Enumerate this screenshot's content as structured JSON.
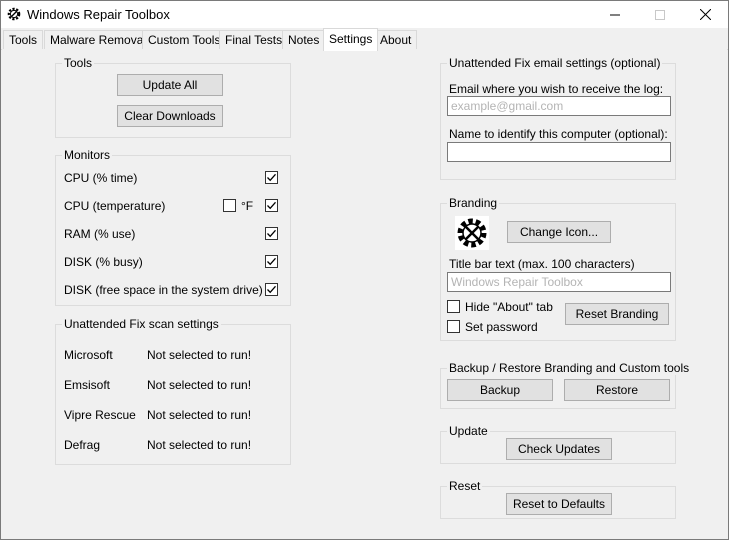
{
  "window": {
    "title": "Windows Repair Toolbox",
    "minimize_icon": "minimize-icon",
    "maximize_icon": "maximize-icon",
    "close_icon": "close-icon",
    "app_icon": "gear-wrench-icon"
  },
  "tabs": [
    {
      "label": "Tools"
    },
    {
      "label": "Malware Removal"
    },
    {
      "label": "Custom Tools"
    },
    {
      "label": "Final Tests"
    },
    {
      "label": "Notes"
    },
    {
      "label": "Settings",
      "active": true
    },
    {
      "label": "About"
    }
  ],
  "tools_group": {
    "title": "Tools",
    "update_all_label": "Update All",
    "clear_downloads_label": "Clear Downloads"
  },
  "monitors": {
    "title": "Monitors",
    "items": [
      {
        "label": "CPU (% time)",
        "checked": true
      },
      {
        "label": "CPU (temperature)",
        "checked": true
      },
      {
        "label": "RAM (% use)",
        "checked": true
      },
      {
        "label": "DISK (% busy)",
        "checked": true
      },
      {
        "label": "DISK (free space in the system drive)",
        "checked": true
      }
    ],
    "fahrenheit_label": "°F",
    "fahrenheit_checked": false
  },
  "scan_settings": {
    "title": "Unattended Fix scan settings",
    "rows": [
      {
        "name": "Microsoft",
        "status": "Not selected to run!"
      },
      {
        "name": "Emsisoft",
        "status": "Not selected to run!"
      },
      {
        "name": "Vipre Rescue",
        "status": "Not selected to run!"
      },
      {
        "name": "Defrag",
        "status": "Not selected to run!"
      }
    ]
  },
  "email_settings": {
    "title": "Unattended Fix email settings (optional)",
    "email_label": "Email where you wish to receive the log:",
    "email_placeholder": "example@gmail.com",
    "computer_label": "Name to identify this computer (optional):",
    "computer_value": ""
  },
  "branding": {
    "title": "Branding",
    "change_icon_label": "Change Icon...",
    "title_bar_label": "Title bar text (max. 100 characters)",
    "title_bar_placeholder": "Windows Repair Toolbox",
    "hide_about_label": "Hide \"About\" tab",
    "hide_about_checked": false,
    "set_password_label": "Set password",
    "set_password_checked": false,
    "reset_branding_label": "Reset Branding",
    "icon": "gear-wrench-icon"
  },
  "backup_restore": {
    "title": "Backup / Restore Branding and Custom tools",
    "backup_label": "Backup",
    "restore_label": "Restore"
  },
  "update": {
    "title": "Update",
    "check_updates_label": "Check Updates"
  },
  "reset": {
    "title": "Reset",
    "reset_defaults_label": "Reset to Defaults"
  }
}
